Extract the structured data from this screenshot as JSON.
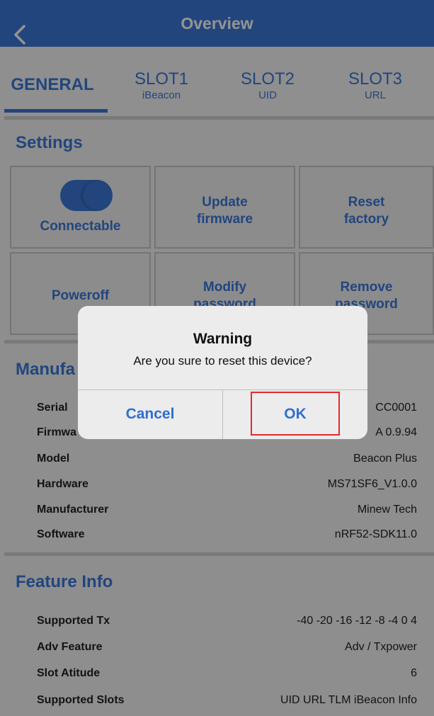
{
  "nav": {
    "title": "Overview"
  },
  "tabs": [
    {
      "label": "GENERAL",
      "sub": ""
    },
    {
      "label": "SLOT1",
      "sub": "iBeacon"
    },
    {
      "label": "SLOT2",
      "sub": "UID"
    },
    {
      "label": "SLOT3",
      "sub": "URL"
    }
  ],
  "settings": {
    "title": "Settings",
    "connectable_label": "Connectable",
    "connectable_on": true,
    "update_line1": "Update",
    "update_line2": "firmware",
    "reset_line1": "Reset",
    "reset_line2": "factory",
    "poweroff_label": "Poweroff",
    "modify_line1": "Modify",
    "modify_line2": "password",
    "remove_line1": "Remove",
    "remove_line2": "password"
  },
  "manufacturer": {
    "title": "Manufa",
    "rows": [
      {
        "label": "Serial",
        "value": "CC0001"
      },
      {
        "label": "Firmwa",
        "value": "A 0.9.94"
      },
      {
        "label": "Model",
        "value": "Beacon Plus"
      },
      {
        "label": "Hardware",
        "value": "MS71SF6_V1.0.0"
      },
      {
        "label": "Manufacturer",
        "value": "Minew Tech"
      },
      {
        "label": "Software",
        "value": "nRF52-SDK11.0"
      }
    ]
  },
  "feature": {
    "title": "Feature Info",
    "rows": [
      {
        "label": "Supported Tx",
        "value": "-40 -20 -16 -12 -8 -4 0 4"
      },
      {
        "label": "Adv Feature",
        "value": "Adv / Txpower"
      },
      {
        "label": "Slot Atitude",
        "value": "6"
      },
      {
        "label": "Supported Slots",
        "value": "UID URL TLM iBeacon Info"
      }
    ]
  },
  "alert": {
    "title": "Warning",
    "message": "Are you sure to reset this device?",
    "cancel_label": "Cancel",
    "ok_label": "OK"
  },
  "colors": {
    "accent": "#3b78d8",
    "highlight": "#e12b2b"
  }
}
